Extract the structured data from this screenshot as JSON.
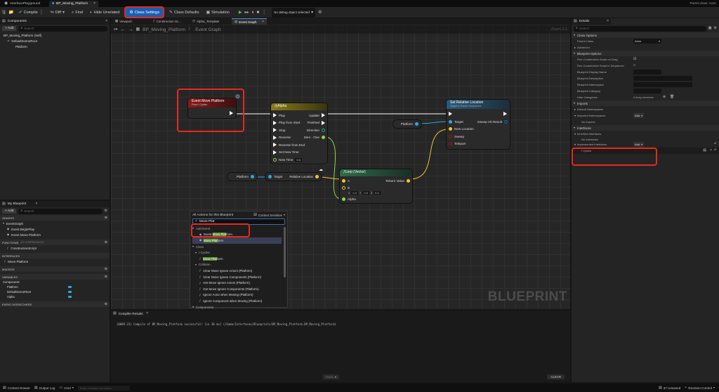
{
  "tabs": {
    "level": "InterfacePlayground",
    "asset": "BP_Moving_Platform"
  },
  "parent_class": "Parent class: Actor",
  "toolbar": {
    "compile": "Compile",
    "diff": "Diff",
    "find": "Find",
    "hide_unrelated": "Hide Unrelated",
    "class_settings": "Class Settings",
    "class_defaults": "Class Defaults",
    "simulation": "Simulation",
    "debug_select": "No debug object selected"
  },
  "components_panel": {
    "title": "Components",
    "add": "+ Add",
    "search_placeholder": "Search",
    "items": [
      "BP_Moving_Platform (Self)",
      "DefaultSceneRoot",
      "Platform"
    ]
  },
  "graph_tabs": [
    "Viewport",
    "Construction Sc...",
    "Alpha_Template",
    "Event Graph"
  ],
  "breadcrumb": {
    "asset": "BP_Moving_Platform",
    "graph": "Event Graph",
    "zoom": "Zoom 1:1"
  },
  "nodes": {
    "event": {
      "title": "Event Move Platform",
      "sub": "From I Cycles"
    },
    "timeline": {
      "title": "Alpha",
      "inputs": [
        "Play",
        "Play from Start",
        "Stop",
        "Reverse",
        "Reverse from End",
        "Set New Time",
        "New Time"
      ],
      "outputs": [
        "Update",
        "Finished",
        "Direction",
        "Zero - One"
      ],
      "new_time": "0.0"
    },
    "set_loc": {
      "title": "Set Relative Location",
      "sub": "Target is Scene Component",
      "inputs": [
        "Target",
        "New Location",
        "Sweep",
        "Teleport"
      ],
      "output": "Sweep Hit Result"
    },
    "platform_var1": "Platform",
    "platform_var2": "Platform",
    "get_loc": {
      "target": "Target",
      "out": "Relative Location"
    },
    "lerp": {
      "title": "Lerp (Vector)",
      "a": "A",
      "b": "B",
      "alpha": "Alpha",
      "ret": "Return Value",
      "bx": "0.0",
      "by": "0.0",
      "bz": "0.0"
    }
  },
  "watermark": "BLUEPRINT",
  "action_menu": {
    "title": "All Actions for this Blueprint",
    "context": "Context Sensitive",
    "query": "Move Plat",
    "items": [
      {
        "t": "Add Event",
        "k": "cat"
      },
      {
        "t": "Event Move Platform",
        "k": "item",
        "pre": "Event ",
        "hl": "Move Plat",
        "post": "form"
      },
      {
        "t": "Move Platform",
        "k": "sel",
        "pre": "",
        "hl": "Move Plat",
        "post": "form"
      },
      {
        "t": "Class",
        "k": "cat"
      },
      {
        "t": "I Cycles",
        "k": "cat2"
      },
      {
        "t": "Move Platform",
        "k": "item",
        "pre": "",
        "hl": "Move Plat",
        "post": "form"
      },
      {
        "t": "Collision",
        "k": "cat2"
      },
      {
        "t": "Clear Move Ignore Actors (Platform)",
        "k": "item"
      },
      {
        "t": "Clear Move Ignore Components (Platform)",
        "k": "item"
      },
      {
        "t": "Get Move Ignore Actors (Platform)",
        "k": "item"
      },
      {
        "t": "Get Move Ignore Components (Platform)",
        "k": "item"
      },
      {
        "t": "Ignore Actor when Moving (Platform)",
        "k": "item"
      },
      {
        "t": "Ignore Component when Moving (Platform)",
        "k": "item"
      },
      {
        "t": "Components",
        "k": "cat"
      }
    ]
  },
  "my_blueprint": {
    "title": "My Blueprint",
    "add": "+ Add",
    "search_placeholder": "Search",
    "graphs_h": "GRAPHS",
    "event_graph": "EventGraph",
    "graph_items": [
      "Event BeginPlay",
      "Event Move Platform"
    ],
    "functions_h": "FUNCTIONS",
    "functions_note": "(22 OVERRIDABLE)",
    "func_items": [
      "ConstructionScript"
    ],
    "interfaces_h": "INTERFACES",
    "interface_items": [
      "Move Platform"
    ],
    "macros_h": "MACROS",
    "variables_h": "VARIABLES",
    "components_h": "Components",
    "var_items": [
      "Platform",
      "DefaultSceneRoot",
      "Alpha"
    ],
    "dispatchers_h": "EVENT DISPATCHERS"
  },
  "compiler": {
    "title": "Compiler Results",
    "log": "[0089.23] Compile of BP_Moving_Platform successful! [in 38 ms] (/Game/Interfaces/Blueprints/BP_Moving_Platform.BP_Moving_Platform)",
    "page": "PAGE",
    "clear": "CLEAR"
  },
  "details": {
    "title": "Details",
    "search_placeholder": "Search",
    "class_options": "Class Options",
    "parent_class_label": "Parent Class",
    "parent_class_value": "Actor",
    "advanced": "Advanced",
    "bp_options": "Blueprint Options",
    "bp_rows": [
      "Run Construction Script on Drag",
      "Run Construction Script in Sequencer",
      "Blueprint Display Name",
      "Blueprint Description",
      "Blueprint Namespace",
      "Blueprint Category",
      "Hide Categories"
    ],
    "array_elems": "0 Array elements",
    "imports": "Imports",
    "default_ns": "Default Namespaces",
    "imported_ns": "Imported Namespaces",
    "add": "Add",
    "no_imports": "No Imports",
    "interfaces": "Interfaces",
    "inherited": "Inherited Interfaces",
    "no_interfaces": "No Interfaces",
    "implemented": "Implemented Interfaces",
    "implemented_item": "I Cycles"
  },
  "status": {
    "content_drawer": "Content Drawer",
    "output_log": "Output Log",
    "cmd": "Cmd",
    "console_placeholder": "Enter Console Command",
    "unsaved": "37 Unsaved",
    "revision": "Revision Control"
  }
}
